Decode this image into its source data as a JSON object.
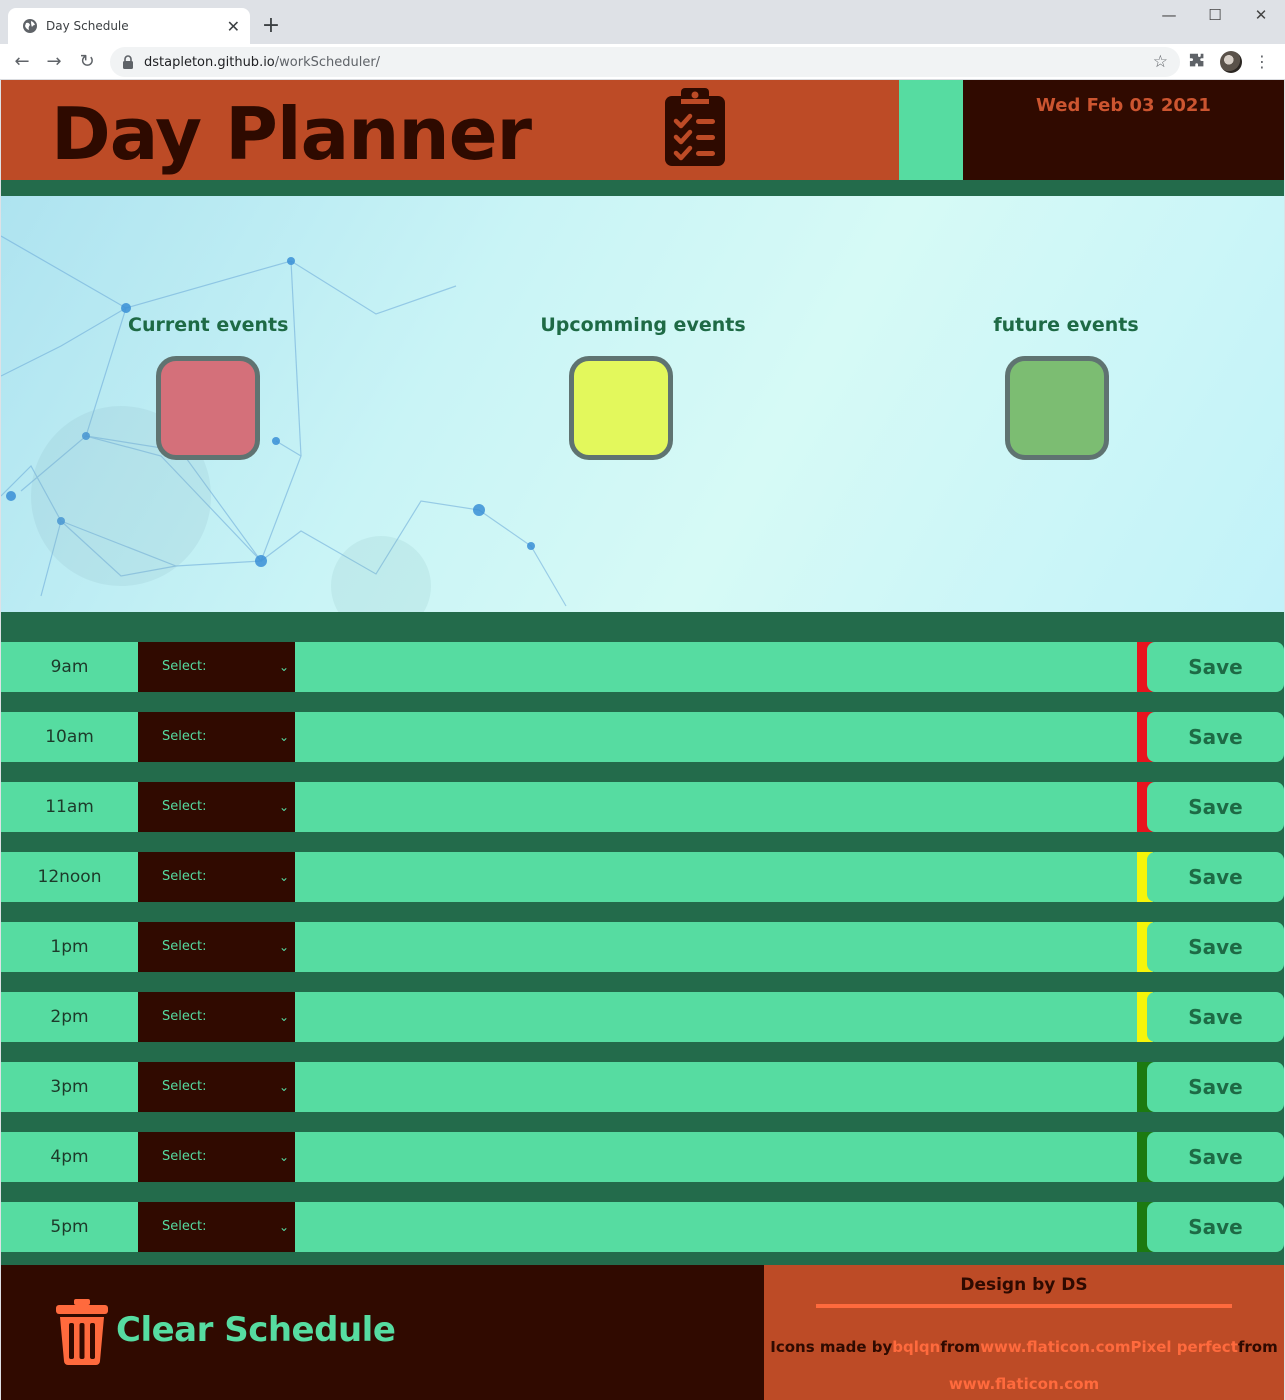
{
  "browser": {
    "tab_title": "Day Schedule",
    "url_domain": "dstapleton.github.io",
    "url_path": "/workScheduler/"
  },
  "header": {
    "title": "Day Planner",
    "date": "Wed Feb 03 2021",
    "icon": "clipboard-checklist-icon"
  },
  "legend": [
    {
      "label": "Current events",
      "color": "#d4707a"
    },
    {
      "label": "Upcomming events",
      "color": "#e3f85c"
    },
    {
      "label": "future events",
      "color": "#7cbd72"
    }
  ],
  "schedule": [
    {
      "hour": "9am",
      "select": "Select:",
      "save": "Save",
      "status_color": "#e8141e"
    },
    {
      "hour": "10am",
      "select": "Select:",
      "save": "Save",
      "status_color": "#e8141e"
    },
    {
      "hour": "11am",
      "select": "Select:",
      "save": "Save",
      "status_color": "#e8141e"
    },
    {
      "hour": "12noon",
      "select": "Select:",
      "save": "Save",
      "status_color": "#f5f50a"
    },
    {
      "hour": "1pm",
      "select": "Select:",
      "save": "Save",
      "status_color": "#f5f50a"
    },
    {
      "hour": "2pm",
      "select": "Select:",
      "save": "Save",
      "status_color": "#f5f50a"
    },
    {
      "hour": "3pm",
      "select": "Select:",
      "save": "Save",
      "status_color": "#1c7a10"
    },
    {
      "hour": "4pm",
      "select": "Select:",
      "save": "Save",
      "status_color": "#1c7a10"
    },
    {
      "hour": "5pm",
      "select": "Select:",
      "save": "Save",
      "status_color": "#1c7a10"
    }
  ],
  "footer": {
    "clear_label": "Clear Schedule",
    "clear_icon": "trash-icon",
    "design": "Design by DS",
    "credits_prefix": "Icons made by",
    "credit_author1": "bqlqn",
    "from1": "from",
    "site1": "www.flaticon.com",
    "credit_author2": "Pixel perfect",
    "from2": "from",
    "site2": "www.flaticon.com"
  },
  "colors": {
    "brand_orange": "#bd4b26",
    "dark_brown": "#300a00",
    "mint": "#56dca1",
    "forest": "#236b4b"
  }
}
